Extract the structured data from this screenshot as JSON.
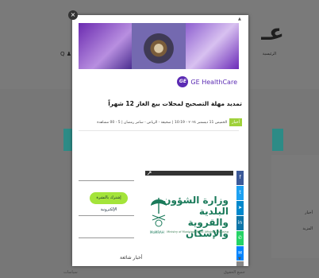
{
  "background": {
    "logo": "عـ",
    "nav_text": "الرئيسية",
    "search_icons": "Q ♟",
    "right_panel_title": "أخبار",
    "right_panel_line": "المزيد",
    "footer_left": "سياسات",
    "footer_right": "جميع الحقوق"
  },
  "modal": {
    "close_label": "×",
    "ge_monogram": "GE",
    "ge_brand": "GE HealthCare",
    "title": "تمديد مهلة التصحيح لمحلات بيع الغاز 12 شهراً",
    "meta_badge": "أخبار",
    "meta_text": "الخميس 11 ديسمبر ٢٠٢٤ - 10:19 | صحيفة - الرياض - سامر رمضان | 5 - 00 مشاهدة",
    "subscribe_label": "إشترك بالنشرة الإلكترونية",
    "latest_news": "أخبار شائعة",
    "ad": {
      "arabic_line1": "وزارة الشؤون البلدية",
      "arabic_line2": "والقروية والإسكان",
      "english": "Ministry of Municipal Rural Affairs & Housing",
      "emblem_label": "MoMRAH"
    },
    "social_icons": [
      "facebook-icon",
      "twitter-icon",
      "telegram-icon",
      "linkedin-icon",
      "whatsapp-icon",
      "messenger-icon",
      "print-icon"
    ],
    "colors": {
      "accent_green": "#a4e43a",
      "ge_purple": "#5b2bb3",
      "teal": "#2d8b86"
    }
  }
}
